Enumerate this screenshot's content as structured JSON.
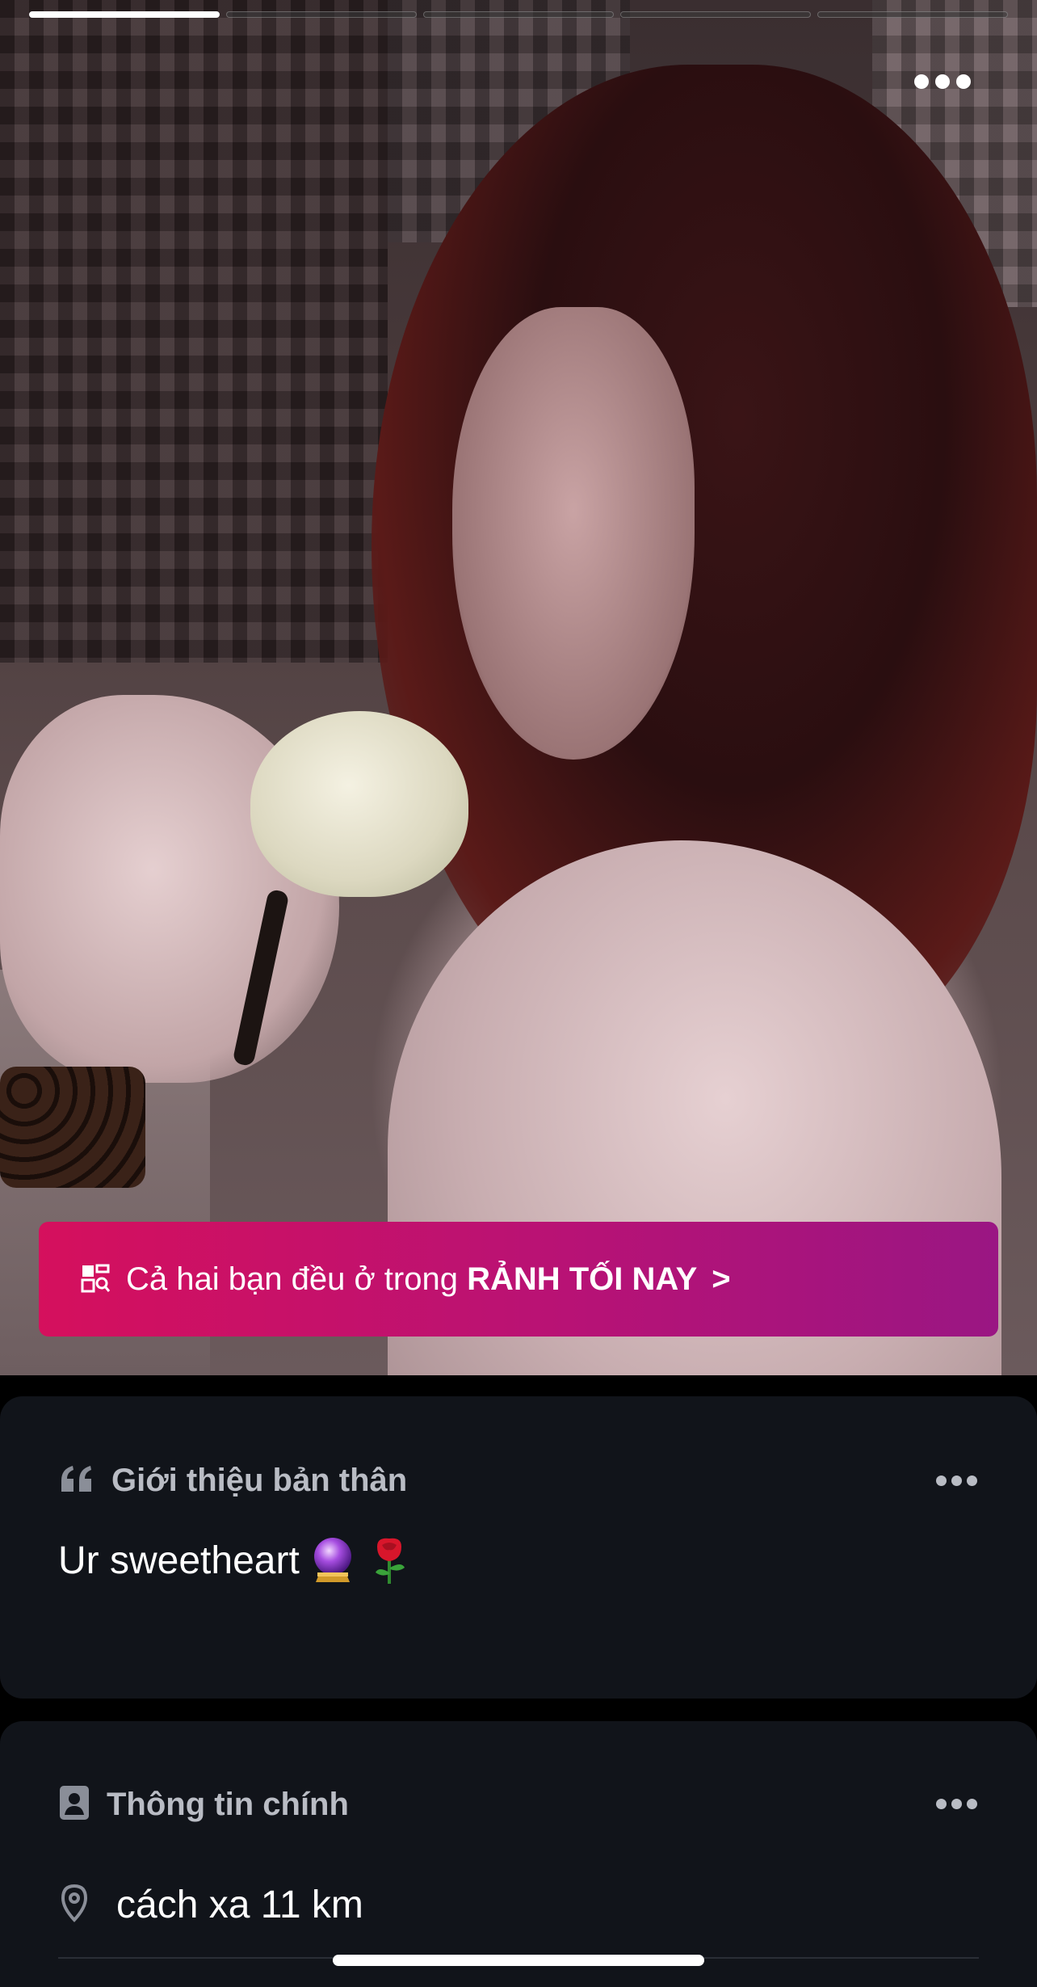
{
  "photo": {
    "progress_segments": 5,
    "active_segment": 1
  },
  "banner": {
    "icon": "preview-search-icon",
    "text_prefix": "Cả hai bạn đều ở trong ",
    "text_bold": "RẢNH TỐI NAY",
    "chevron": ">",
    "colors": {
      "start": "#d5105d",
      "end": "#9a1683"
    }
  },
  "intro_card": {
    "icon": "quote-icon",
    "title": "Giới thiệu bản thân",
    "bio": "Ur sweetheart",
    "emojis": [
      "crystal-ball",
      "rose"
    ]
  },
  "info_card": {
    "icon": "id-card-icon",
    "title": "Thông tin chính",
    "distance_icon": "location-pin-icon",
    "distance": "cách xa 11 km"
  },
  "theme": {
    "card_bg": "#11141a",
    "muted_text": "#b9bcc4"
  }
}
